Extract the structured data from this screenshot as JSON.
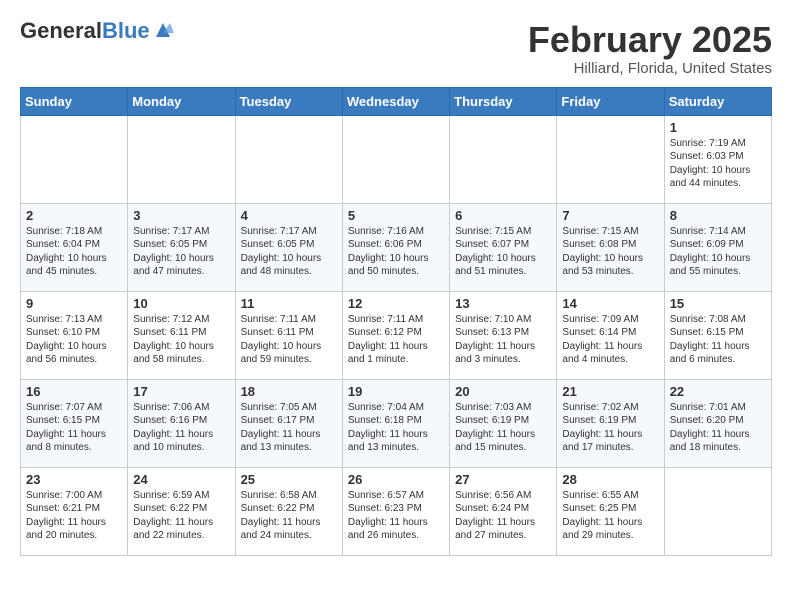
{
  "header": {
    "logo_general": "General",
    "logo_blue": "Blue",
    "month_title": "February 2025",
    "location": "Hilliard, Florida, United States"
  },
  "weekdays": [
    "Sunday",
    "Monday",
    "Tuesday",
    "Wednesday",
    "Thursday",
    "Friday",
    "Saturday"
  ],
  "weeks": [
    [
      {
        "day": "",
        "info": ""
      },
      {
        "day": "",
        "info": ""
      },
      {
        "day": "",
        "info": ""
      },
      {
        "day": "",
        "info": ""
      },
      {
        "day": "",
        "info": ""
      },
      {
        "day": "",
        "info": ""
      },
      {
        "day": "1",
        "info": "Sunrise: 7:19 AM\nSunset: 6:03 PM\nDaylight: 10 hours\nand 44 minutes."
      }
    ],
    [
      {
        "day": "2",
        "info": "Sunrise: 7:18 AM\nSunset: 6:04 PM\nDaylight: 10 hours\nand 45 minutes."
      },
      {
        "day": "3",
        "info": "Sunrise: 7:17 AM\nSunset: 6:05 PM\nDaylight: 10 hours\nand 47 minutes."
      },
      {
        "day": "4",
        "info": "Sunrise: 7:17 AM\nSunset: 6:05 PM\nDaylight: 10 hours\nand 48 minutes."
      },
      {
        "day": "5",
        "info": "Sunrise: 7:16 AM\nSunset: 6:06 PM\nDaylight: 10 hours\nand 50 minutes."
      },
      {
        "day": "6",
        "info": "Sunrise: 7:15 AM\nSunset: 6:07 PM\nDaylight: 10 hours\nand 51 minutes."
      },
      {
        "day": "7",
        "info": "Sunrise: 7:15 AM\nSunset: 6:08 PM\nDaylight: 10 hours\nand 53 minutes."
      },
      {
        "day": "8",
        "info": "Sunrise: 7:14 AM\nSunset: 6:09 PM\nDaylight: 10 hours\nand 55 minutes."
      }
    ],
    [
      {
        "day": "9",
        "info": "Sunrise: 7:13 AM\nSunset: 6:10 PM\nDaylight: 10 hours\nand 56 minutes."
      },
      {
        "day": "10",
        "info": "Sunrise: 7:12 AM\nSunset: 6:11 PM\nDaylight: 10 hours\nand 58 minutes."
      },
      {
        "day": "11",
        "info": "Sunrise: 7:11 AM\nSunset: 6:11 PM\nDaylight: 10 hours\nand 59 minutes."
      },
      {
        "day": "12",
        "info": "Sunrise: 7:11 AM\nSunset: 6:12 PM\nDaylight: 11 hours\nand 1 minute."
      },
      {
        "day": "13",
        "info": "Sunrise: 7:10 AM\nSunset: 6:13 PM\nDaylight: 11 hours\nand 3 minutes."
      },
      {
        "day": "14",
        "info": "Sunrise: 7:09 AM\nSunset: 6:14 PM\nDaylight: 11 hours\nand 4 minutes."
      },
      {
        "day": "15",
        "info": "Sunrise: 7:08 AM\nSunset: 6:15 PM\nDaylight: 11 hours\nand 6 minutes."
      }
    ],
    [
      {
        "day": "16",
        "info": "Sunrise: 7:07 AM\nSunset: 6:15 PM\nDaylight: 11 hours\nand 8 minutes."
      },
      {
        "day": "17",
        "info": "Sunrise: 7:06 AM\nSunset: 6:16 PM\nDaylight: 11 hours\nand 10 minutes."
      },
      {
        "day": "18",
        "info": "Sunrise: 7:05 AM\nSunset: 6:17 PM\nDaylight: 11 hours\nand 13 minutes."
      },
      {
        "day": "19",
        "info": "Sunrise: 7:04 AM\nSunset: 6:18 PM\nDaylight: 11 hours\nand 13 minutes."
      },
      {
        "day": "20",
        "info": "Sunrise: 7:03 AM\nSunset: 6:19 PM\nDaylight: 11 hours\nand 15 minutes."
      },
      {
        "day": "21",
        "info": "Sunrise: 7:02 AM\nSunset: 6:19 PM\nDaylight: 11 hours\nand 17 minutes."
      },
      {
        "day": "22",
        "info": "Sunrise: 7:01 AM\nSunset: 6:20 PM\nDaylight: 11 hours\nand 18 minutes."
      }
    ],
    [
      {
        "day": "23",
        "info": "Sunrise: 7:00 AM\nSunset: 6:21 PM\nDaylight: 11 hours\nand 20 minutes."
      },
      {
        "day": "24",
        "info": "Sunrise: 6:59 AM\nSunset: 6:22 PM\nDaylight: 11 hours\nand 22 minutes."
      },
      {
        "day": "25",
        "info": "Sunrise: 6:58 AM\nSunset: 6:22 PM\nDaylight: 11 hours\nand 24 minutes."
      },
      {
        "day": "26",
        "info": "Sunrise: 6:57 AM\nSunset: 6:23 PM\nDaylight: 11 hours\nand 26 minutes."
      },
      {
        "day": "27",
        "info": "Sunrise: 6:56 AM\nSunset: 6:24 PM\nDaylight: 11 hours\nand 27 minutes."
      },
      {
        "day": "28",
        "info": "Sunrise: 6:55 AM\nSunset: 6:25 PM\nDaylight: 11 hours\nand 29 minutes."
      },
      {
        "day": "",
        "info": ""
      }
    ]
  ]
}
